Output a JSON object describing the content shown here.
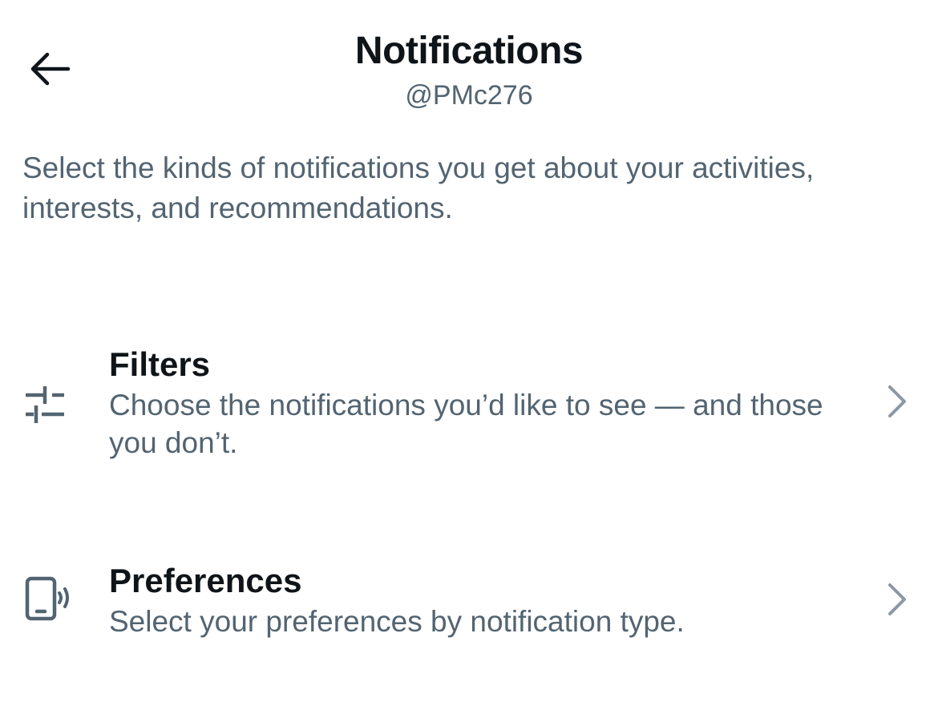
{
  "header": {
    "title": "Notifications",
    "subtitle": "@PMc276",
    "back_icon": "arrow-left-icon"
  },
  "description": "Select the kinds of notifications you get about your activities, interests, and recommendations.",
  "items": [
    {
      "icon": "sliders-icon",
      "title": "Filters",
      "subtitle": "Choose the notifications you’d like to see — and those you don’t.",
      "chevron_icon": "chevron-right-icon"
    },
    {
      "icon": "phone-vibrate-icon",
      "title": "Preferences",
      "subtitle": "Select your preferences by notification type.",
      "chevron_icon": "chevron-right-icon"
    }
  ],
  "colors": {
    "primary_text": "#0f1419",
    "secondary_text": "#536471",
    "chevron": "#8b98a5",
    "background": "#ffffff"
  }
}
